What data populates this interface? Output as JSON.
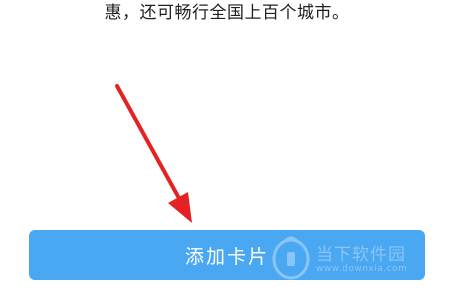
{
  "description": {
    "text": "惠，还可畅行全国上百个城市。"
  },
  "add_card_button": {
    "label": "添加卡片"
  },
  "annotation": {
    "arrow_color": "#e52222"
  },
  "watermark": {
    "brand": "当下软件园",
    "url": "www.downxia.com",
    "icon": "downxia-logo-icon"
  },
  "colors": {
    "button_background": "#4aa7f2",
    "button_text": "#ffffff",
    "body_text": "#1f1f1f"
  }
}
